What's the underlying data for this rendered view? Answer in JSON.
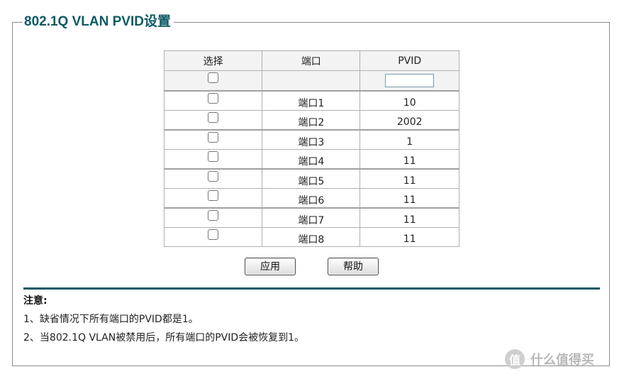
{
  "section_title": "802.1Q VLAN PVID设置",
  "table": {
    "headers": {
      "select": "选择",
      "port": "端口",
      "pvid": "PVID"
    },
    "filter_pvid_value": "",
    "rows": [
      {
        "port": "端口1",
        "pvid": "10"
      },
      {
        "port": "端口2",
        "pvid": "2002"
      },
      {
        "port": "端口3",
        "pvid": "1"
      },
      {
        "port": "端口4",
        "pvid": "11"
      },
      {
        "port": "端口5",
        "pvid": "11"
      },
      {
        "port": "端口6",
        "pvid": "11"
      },
      {
        "port": "端口7",
        "pvid": "11"
      },
      {
        "port": "端口8",
        "pvid": "11"
      }
    ]
  },
  "buttons": {
    "apply": "应用",
    "help": "帮助"
  },
  "notes": {
    "title": "注意:",
    "items": [
      "1、缺省情况下所有端口的PVID都是1。",
      "2、当802.1Q VLAN被禁用后，所有端口的PVID会被恢复到1。"
    ]
  },
  "watermark": {
    "logo": "值",
    "text": "什么值得买"
  },
  "colors": {
    "accent": "#0d5a66"
  }
}
